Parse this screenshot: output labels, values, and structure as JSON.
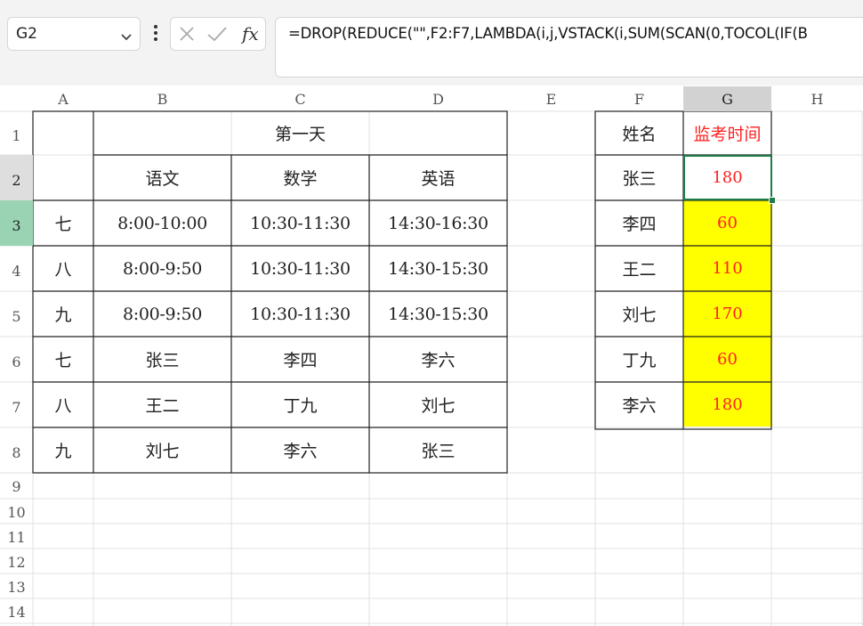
{
  "name_box": {
    "value": "G2"
  },
  "formula_bar": {
    "fx_label": "fx",
    "formula": "=DROP(REDUCE(\"\",F2:F7,LAMBDA(i,j,VSTACK(i,SUM(SCAN(0,TOCOL(IF(B"
  },
  "columns": [
    "A",
    "B",
    "C",
    "D",
    "E",
    "F",
    "G",
    "H"
  ],
  "rows": [
    "1",
    "2",
    "3",
    "4",
    "5",
    "6",
    "7",
    "8",
    "9",
    "10",
    "11",
    "12",
    "13",
    "14"
  ],
  "schedule": {
    "header_merged": "第一天",
    "subjects": [
      "语文",
      "数学",
      "英语"
    ],
    "rows": [
      {
        "label": "七",
        "cells": [
          "8:00-10:00",
          "10:30-11:30",
          "14:30-16:30"
        ]
      },
      {
        "label": "八",
        "cells": [
          "8:00-9:50",
          "10:30-11:30",
          "14:30-15:30"
        ]
      },
      {
        "label": "九",
        "cells": [
          "8:00-9:50",
          "10:30-11:30",
          "14:30-15:30"
        ]
      },
      {
        "label": "七",
        "cells": [
          "张三",
          "李四",
          "李六"
        ]
      },
      {
        "label": "八",
        "cells": [
          "王二",
          "丁九",
          "刘七"
        ]
      },
      {
        "label": "九",
        "cells": [
          "刘七",
          "李六",
          "张三"
        ]
      }
    ]
  },
  "result": {
    "header_name": "姓名",
    "header_time": "监考时间",
    "rows": [
      {
        "name": "张三",
        "time": "180"
      },
      {
        "name": "李四",
        "time": "60"
      },
      {
        "name": "王二",
        "time": "110"
      },
      {
        "name": "刘七",
        "time": "170"
      },
      {
        "name": "丁九",
        "time": "60"
      },
      {
        "name": "李六",
        "time": "180"
      }
    ]
  },
  "colors": {
    "highlight": "#ffff00",
    "result_text": "#ff2222",
    "selection": "#1e7b48"
  }
}
